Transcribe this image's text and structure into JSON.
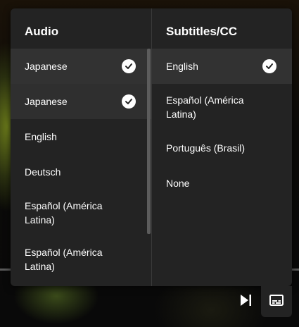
{
  "audio": {
    "header": "Audio",
    "items": [
      {
        "label": "Japanese",
        "checked": true
      },
      {
        "label": "Japanese",
        "checked": true
      },
      {
        "label": "English",
        "checked": false
      },
      {
        "label": "Deutsch",
        "checked": false
      },
      {
        "label": "Español (América Latina)",
        "checked": false
      },
      {
        "label": "Español (América Latina)",
        "checked": false
      }
    ]
  },
  "subtitles": {
    "header": "Subtitles/CC",
    "items": [
      {
        "label": "English",
        "checked": true
      },
      {
        "label": "Español (América Latina)",
        "checked": false
      },
      {
        "label": "Português (Brasil)",
        "checked": false
      },
      {
        "label": "None",
        "checked": false
      }
    ]
  },
  "controls": {
    "next_icon": "skip-next-icon",
    "cc_icon": "subtitles-icon"
  },
  "colors": {
    "panel_bg": "#232323",
    "selected_bg": "#323232",
    "text": "#ffffff"
  }
}
